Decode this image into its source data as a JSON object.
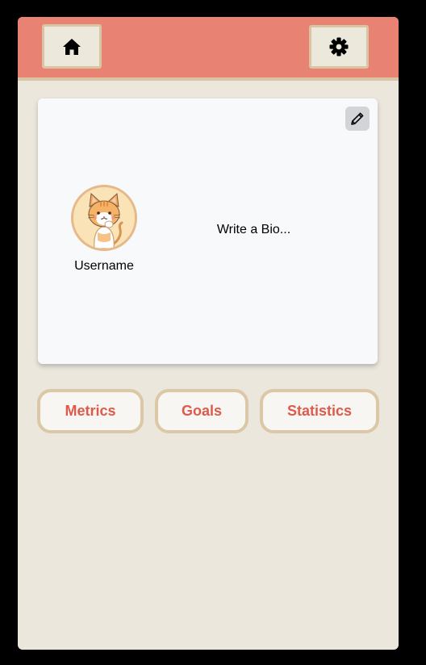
{
  "header": {
    "home_icon": "home-icon",
    "settings_icon": "gear-icon"
  },
  "profile": {
    "edit_icon": "pencil-icon",
    "avatar": "cat-avatar",
    "username": "Username",
    "bio_placeholder": "Write a Bio..."
  },
  "tabs": [
    {
      "label": "Metrics"
    },
    {
      "label": "Goals"
    },
    {
      "label": "Statistics"
    }
  ],
  "colors": {
    "header": "#e88374",
    "background": "#ebe7dd",
    "card": "#f8f9fa",
    "accent_text": "#dd5a4c",
    "border": "#d9c4a3"
  }
}
